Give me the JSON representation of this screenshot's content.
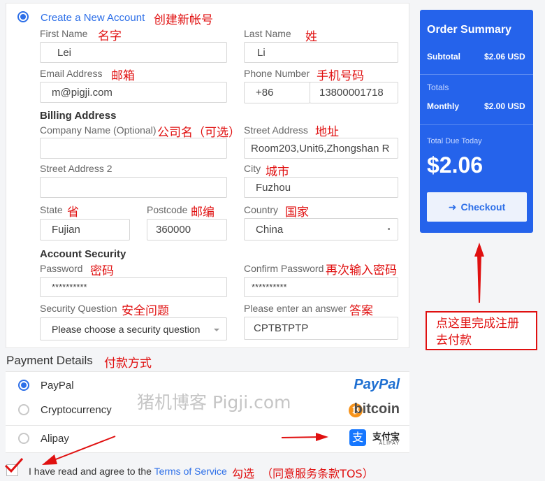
{
  "account": {
    "create_label": "Create a New Account",
    "create_ann": "创建新帐号",
    "first_name_label": "First Name",
    "first_name_ann": "名字",
    "first_name_value": "Lei",
    "last_name_label": "Last Name",
    "last_name_ann": "姓",
    "last_name_value": "Li",
    "email_label": "Email Address",
    "email_ann": "邮箱",
    "email_value": "m@pigji.com",
    "phone_label": "Phone Number",
    "phone_ann": "手机号码",
    "phone_code": "+86",
    "phone_value": "13800001718"
  },
  "billing": {
    "title": "Billing Address",
    "company_label": "Company Name (Optional)",
    "company_ann": "公司名（可选）",
    "company_value": "",
    "street_label": "Street Address",
    "street_ann": "地址",
    "street_value": "Room203,Unit6,Zhongshan R",
    "street2_label": "Street Address 2",
    "street2_value": "",
    "city_label": "City",
    "city_ann": "城市",
    "city_value": "Fuzhou",
    "state_label": "State",
    "state_ann": "省",
    "state_value": "Fujian",
    "postcode_label": "Postcode",
    "postcode_ann": "邮编",
    "postcode_value": "360000",
    "country_label": "Country",
    "country_ann": "国家",
    "country_value": "China"
  },
  "security": {
    "title": "Account Security",
    "password_label": "Password",
    "password_ann": "密码",
    "password_value": "**********",
    "confirm_label": "Confirm Password",
    "confirm_ann": "再次输入密码",
    "confirm_value": "**********",
    "question_label": "Security Question",
    "question_ann": "安全问题",
    "question_placeholder": "Please choose a security question",
    "answer_label": "Please enter an answer",
    "answer_ann": "答案",
    "answer_value": "CPTBTPTP"
  },
  "payment": {
    "title": "Payment Details",
    "title_ann": "付款方式",
    "options": [
      {
        "name": "PayPal",
        "logo": "PayPal",
        "selected": true
      },
      {
        "name": "Cryptocurrency",
        "logo": "bitcoin",
        "selected": false
      },
      {
        "name": "Alipay",
        "logo_main": "支付宝",
        "logo_sub": "ALIPAY",
        "selected": false
      }
    ],
    "watermark": "猪机博客 Pigji.com"
  },
  "tos": {
    "prefix": "I have read and agree to the",
    "link": "Terms of Service",
    "ann": "勾选  （同意服务条款TOS）",
    "checked": true
  },
  "summary": {
    "title": "Order Summary",
    "subtotal_label": "Subtotal",
    "subtotal_value": "$2.06 USD",
    "totals_label": "Totals",
    "monthly_label": "Monthly",
    "monthly_value": "$2.00 USD",
    "due_label": "Total Due Today",
    "due_value": "$2.06",
    "checkout_label": "Checkout",
    "checkout_ann": "点这里完成注册\n去付款"
  },
  "colors": {
    "accent": "#2563eb",
    "annotation": "#e01010",
    "link": "#2d6fe8"
  }
}
